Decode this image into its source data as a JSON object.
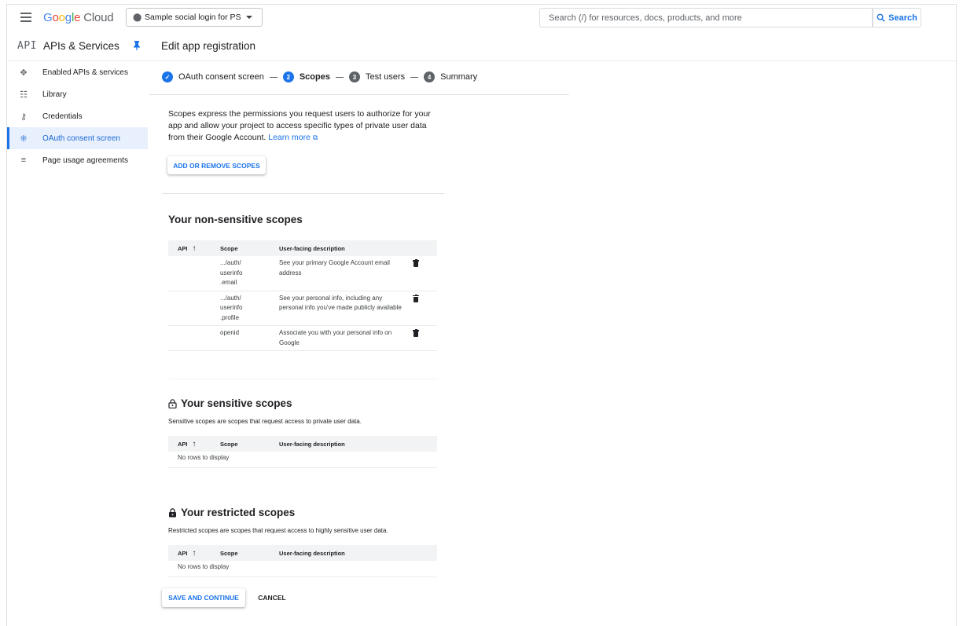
{
  "topbar": {
    "brand": "Google Cloud",
    "project": "Sample social login for PS",
    "search_placeholder": "Search (/) for resources, docs, products, and more",
    "search_button": "Search"
  },
  "subheader": {
    "api_logo": "API",
    "section_title": "APIs & Services",
    "page_title": "Edit app registration"
  },
  "sidebar": {
    "items": [
      {
        "label": "Enabled APIs & services",
        "icon": "diamond-arrows-icon"
      },
      {
        "label": "Library",
        "icon": "library-icon"
      },
      {
        "label": "Credentials",
        "icon": "key-icon"
      },
      {
        "label": "OAuth consent screen",
        "icon": "oauth-icon",
        "active": true
      },
      {
        "label": "Page usage agreements",
        "icon": "settings-list-icon"
      }
    ]
  },
  "stepper": {
    "steps": [
      {
        "number": "✓",
        "label": "OAuth consent screen",
        "state": "done"
      },
      {
        "number": "2",
        "label": "Scopes",
        "state": "active"
      },
      {
        "number": "3",
        "label": "Test users",
        "state": "pending"
      },
      {
        "number": "4",
        "label": "Summary",
        "state": "pending"
      }
    ]
  },
  "intro": {
    "text": "Scopes express the permissions you request users to authorize for your app and allow your project to access specific types of private user data from their Google Account.",
    "learn_more": "Learn more",
    "add_remove_button": "ADD OR REMOVE SCOPES"
  },
  "non_sensitive": {
    "heading": "Your non-sensitive scopes",
    "columns": [
      "API",
      "Scope",
      "User-facing description"
    ],
    "rows": [
      {
        "api": "",
        "scope": ".../auth/ userinfo .email",
        "description": "See your primary Google Account email address"
      },
      {
        "api": "",
        "scope": ".../auth/ userinfo .profile",
        "description": "See your personal info, including any personal info you've made publicly available"
      },
      {
        "api": "",
        "scope": "openid",
        "description": "Associate you with your personal info on Google"
      }
    ]
  },
  "sensitive": {
    "heading": "Your sensitive scopes",
    "description": "Sensitive scopes are scopes that request access to private user data.",
    "columns": [
      "API",
      "Scope",
      "User-facing description"
    ],
    "empty": "No rows to display"
  },
  "restricted": {
    "heading": "Your restricted scopes",
    "description": "Restricted scopes are scopes that request access to highly sensitive user data.",
    "columns": [
      "API",
      "Scope",
      "User-facing description"
    ],
    "empty": "No rows to display"
  },
  "actions": {
    "save": "SAVE AND CONTINUE",
    "cancel": "CANCEL"
  },
  "colors": {
    "accent": "#1a73e8",
    "active_bg": "#e8f0fe"
  }
}
